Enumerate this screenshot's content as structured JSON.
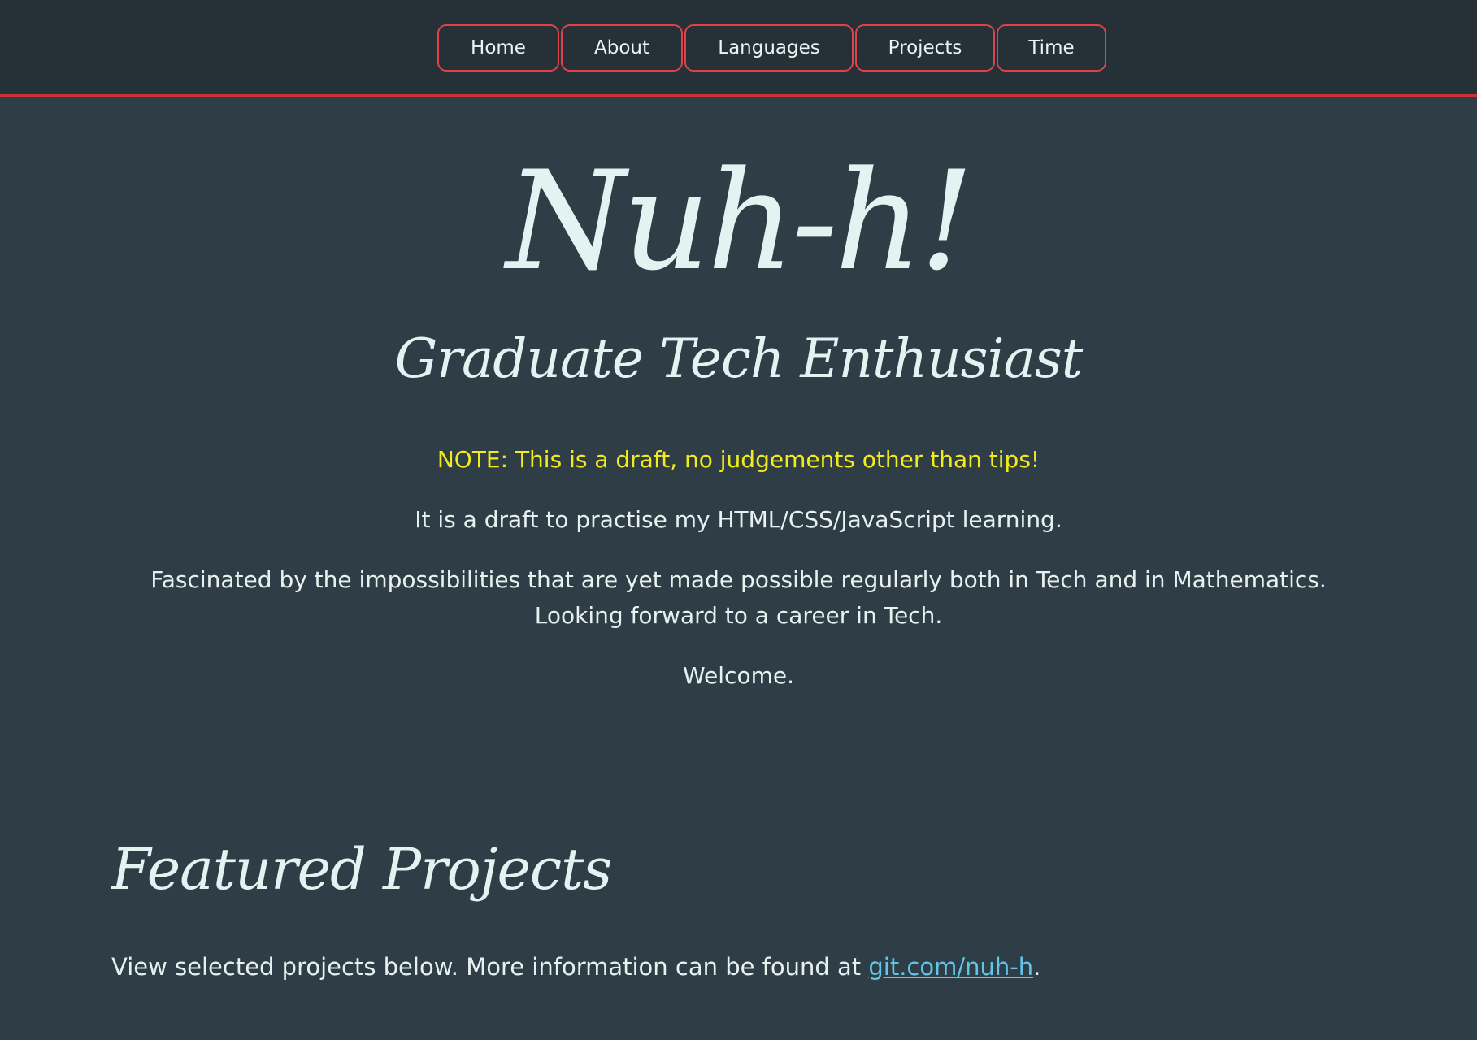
{
  "nav": {
    "items": [
      {
        "label": "Home"
      },
      {
        "label": "About"
      },
      {
        "label": "Languages"
      },
      {
        "label": "Projects"
      },
      {
        "label": "Time"
      }
    ]
  },
  "hero": {
    "title": "Nuh-h!",
    "subtitle": "Graduate Tech Enthusiast",
    "note": "NOTE: This is a draft, no judgements other than tips!",
    "line1": "It is a draft to practise my HTML/CSS/JavaScript learning.",
    "line2a": "Fascinated by the impossibilities that are yet made possible regularly both in Tech and in Mathematics.",
    "line2b": "Looking forward to a career in Tech.",
    "welcome": "Welcome."
  },
  "featured": {
    "title": "Featured Projects",
    "text_before": "View selected projects below. More information can be found at ",
    "link_text": "git.com/nuh-h",
    "text_after": "."
  },
  "colors": {
    "background": "#2f3e46",
    "nav_background": "#253037",
    "accent_red": "#e0424a",
    "note_yellow": "#f3ec1a",
    "link_blue": "#5fc6ea"
  }
}
